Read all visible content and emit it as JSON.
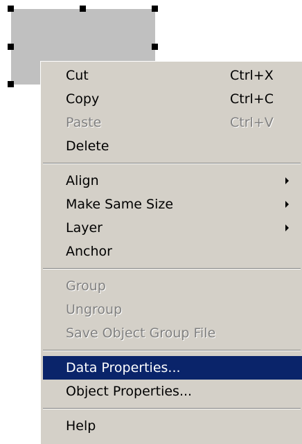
{
  "context_menu": {
    "items": [
      {
        "label": "Cut",
        "shortcut": "Ctrl+X"
      },
      {
        "label": "Copy",
        "shortcut": "Ctrl+C"
      },
      {
        "label": "Paste",
        "shortcut": "Ctrl+V",
        "disabled": true
      },
      {
        "label": "Delete"
      },
      {
        "label": "Align",
        "submenu": true
      },
      {
        "label": "Make Same Size",
        "submenu": true
      },
      {
        "label": "Layer",
        "submenu": true
      },
      {
        "label": "Anchor"
      },
      {
        "label": "Group",
        "disabled": true
      },
      {
        "label": "Ungroup",
        "disabled": true
      },
      {
        "label": "Save Object Group File",
        "disabled": true
      },
      {
        "label": "Data Properties...",
        "highlighted": true
      },
      {
        "label": "Object Properties..."
      },
      {
        "label": "Help"
      }
    ]
  },
  "colors": {
    "menu_background": "#d4d0c8",
    "highlight_background": "#0a246a",
    "disabled_text": "#808080",
    "selected_object_fill": "#c0c0c0"
  }
}
